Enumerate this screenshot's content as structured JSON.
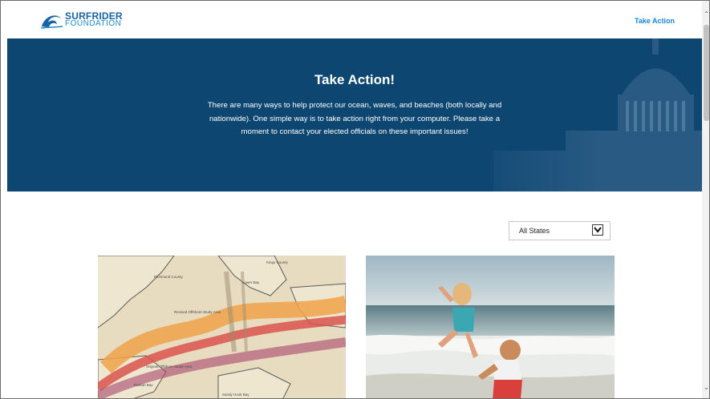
{
  "header": {
    "logo_line1": "SURFRIDER",
    "logo_line2": "FOUNDATION",
    "nav_take_action": "Take Action"
  },
  "hero": {
    "title": "Take Action!",
    "text": "There are many ways to help protect our ocean, waves, and beaches (both locally and nationwide). One simple way is to take action right from your computer. Please take a moment to contact your elected officials on these important issues!"
  },
  "filter": {
    "state_selected": "All States"
  },
  "map_labels": {
    "county_a": "Richmond County",
    "county_b": "Kings County",
    "bay_lower": "Lower Bay",
    "study_revised": "Revised Offshore Study Area",
    "study_original": "Original Offshore Study Area",
    "bay_raritan": "Raritan Bay",
    "hook": "Sandy Hook Bay"
  },
  "colors": {
    "brand_blue": "#1763a8",
    "link_blue": "#1689d6",
    "hero_bg": "#0d4671"
  }
}
